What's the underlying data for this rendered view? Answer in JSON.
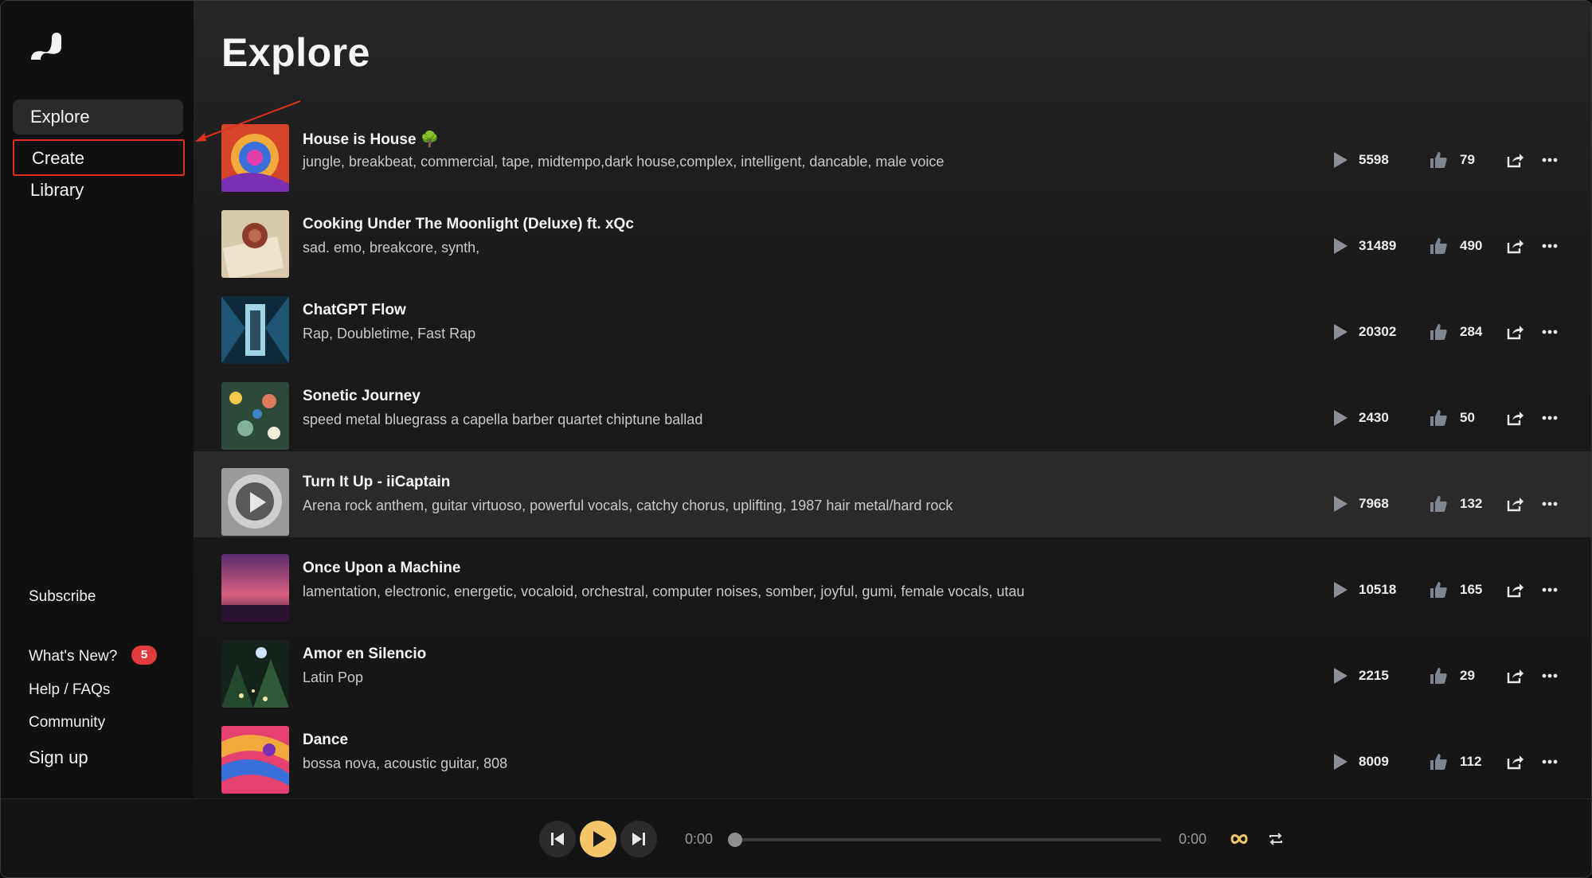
{
  "sidebar": {
    "nav": [
      "Explore",
      "Create",
      "Library"
    ],
    "subscribe": "Subscribe",
    "whats_new": "What's New?",
    "whats_new_badge": "5",
    "help": "Help / FAQs",
    "community": "Community",
    "signup": "Sign up"
  },
  "page": {
    "title": "Explore"
  },
  "songs": [
    {
      "title": "House is House 🌳",
      "tags": "jungle, breakbeat, commercial, tape, midtempo,dark house,complex, intelligent, dancable, male voice",
      "plays": "5598",
      "likes": "79"
    },
    {
      "title": "Cooking Under The Moonlight (Deluxe) ft. xQc",
      "tags": "sad. emo, breakcore, synth,",
      "plays": "31489",
      "likes": "490"
    },
    {
      "title": "ChatGPT Flow",
      "tags": "Rap, Doubletime, Fast Rap",
      "plays": "20302",
      "likes": "284"
    },
    {
      "title": "Sonetic Journey",
      "tags": "speed metal bluegrass a capella barber quartet chiptune ballad",
      "plays": "2430",
      "likes": "50"
    },
    {
      "title": "Turn It Up - iiCaptain",
      "tags": "Arena rock anthem, guitar virtuoso, powerful vocals, catchy chorus, uplifting, 1987 hair metal/hard rock",
      "plays": "7968",
      "likes": "132"
    },
    {
      "title": "Once Upon a Machine",
      "tags": "lamentation, electronic, energetic, vocaloid, orchestral, computer noises, somber, joyful, gumi, female vocals, utau",
      "plays": "10518",
      "likes": "165"
    },
    {
      "title": "Amor en Silencio",
      "tags": "Latin Pop",
      "plays": "2215",
      "likes": "29"
    },
    {
      "title": "Dance",
      "tags": "bossa nova, acoustic guitar, 808",
      "plays": "8009",
      "likes": "112"
    }
  ],
  "player": {
    "current_time": "0:00",
    "total_time": "0:00",
    "progress": 0
  },
  "colors": {
    "accent": "#f5c56a",
    "badge": "#e23b3b",
    "highlight_box": "#e0301e"
  }
}
